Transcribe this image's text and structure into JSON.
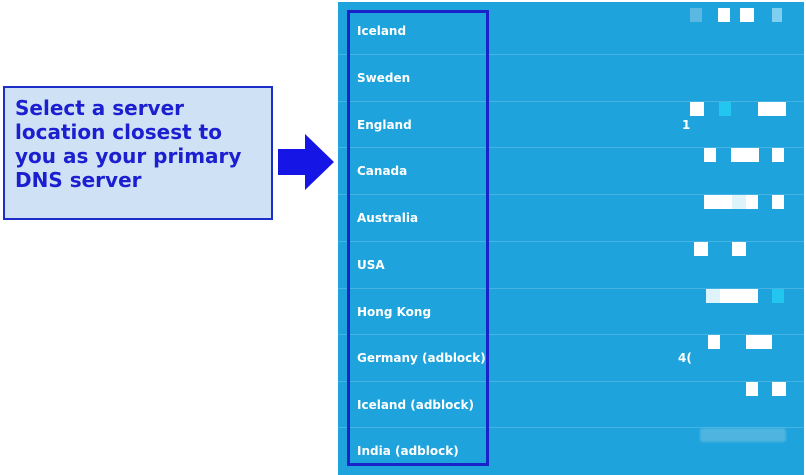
{
  "callout": {
    "text": "Select a server location closest to you as your primary DNS server"
  },
  "servers": [
    {
      "name": "Iceland",
      "ip_visible": ""
    },
    {
      "name": "Sweden",
      "ip_visible": ""
    },
    {
      "name": "England",
      "ip_visible": "1"
    },
    {
      "name": "Canada",
      "ip_visible": ""
    },
    {
      "name": "Australia",
      "ip_visible": ""
    },
    {
      "name": "USA",
      "ip_visible": ""
    },
    {
      "name": "Hong Kong",
      "ip_visible": ""
    },
    {
      "name": "Germany (adblock)",
      "ip_visible": "4("
    },
    {
      "name": "Iceland (adblock)",
      "ip_visible": ""
    },
    {
      "name": "India (adblock)",
      "ip_visible": ""
    }
  ],
  "colors": {
    "panel_background": "#1ea3dc",
    "highlight_border": "#1a23c9",
    "callout_background": "#cfe1f5",
    "callout_text": "#1b1fd0"
  },
  "icons": {
    "pointer": "right-arrow-icon"
  }
}
